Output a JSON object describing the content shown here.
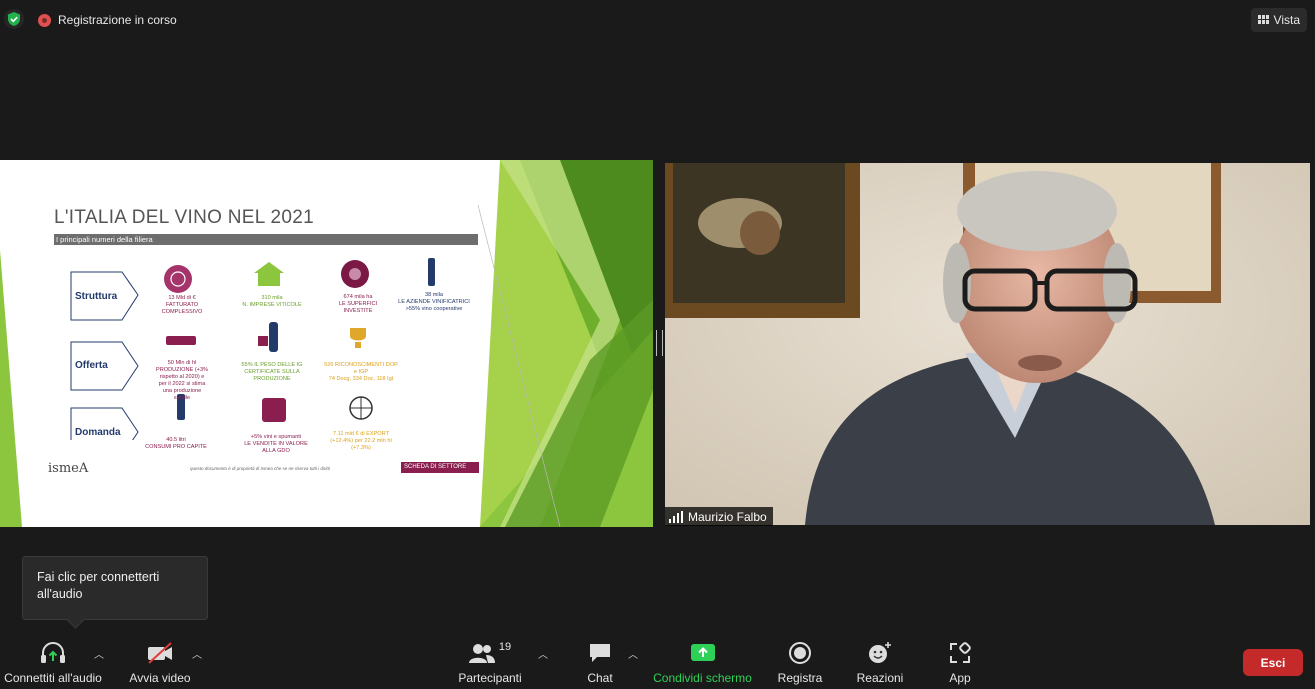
{
  "topbar": {
    "recording_label": "Registrazione in corso",
    "view_label": "Vista"
  },
  "slide": {
    "title": "L'ITALIA DEL VINO NEL 2021",
    "subtitle": "I principali numeri della filiera",
    "categories": [
      "Struttura",
      "Offerta",
      "Domanda"
    ],
    "stats": [
      {
        "text": "13  Mld di €\nFATTURATO\nCOMPLESSIVO",
        "color": "#8a1e4f"
      },
      {
        "text": "310 mila\nN. IMPRESE VITICOLE",
        "color": "#6aa02a"
      },
      {
        "text": "674 mila ha\nLE SUPERFICI\nINVESTITE",
        "color": "#8a1e4f"
      },
      {
        "text": "38 mila\nLE AZIENDE VINIFICATRICI\n>55% vino cooperative",
        "color": "#233a6b"
      },
      {
        "text": "50 Mln di hl\nPRODUZIONE (+3%\nrispetto al 2020) e\nper il 2022 si stima\nuna produzione\nstabile",
        "color": "#8a1e4f"
      },
      {
        "text": "55% IL PESO DELLE IG\nCERTIFICATE SULLA\nPRODUZIONE",
        "color": "#6aa02a"
      },
      {
        "text": "526 RICONOSCIMENTI DOP\ne IGP\n74 Docg, 334 Doc, 118 Igt",
        "color": "#d9a21b"
      },
      {
        "text": "40.5 litri\nCONSUMI PRO CAPITE",
        "color": "#8a1e4f"
      },
      {
        "text": "+5% vini e spumanti\nLE VENDITE IN VALORE\nALLA GDO",
        "color": "#8a1e4f"
      },
      {
        "text": "7.11 mld € di EXPORT\n(+12.4%) per 22.2 mln hl\n(+7.3%)",
        "color": "#d9a21b"
      }
    ],
    "footer_note": "questo documento è di proprietà di Ismea che se ne riserva tutti i diritti",
    "badge": "SCHEDA  DI SETTORE",
    "logo": "ismeA"
  },
  "participant": {
    "name": "Maurizio Falbo"
  },
  "tooltip": {
    "text": "Fai clic per connetterti all'audio"
  },
  "toolbar": {
    "audio_label": "Connettiti all'audio",
    "video_label": "Avvia video",
    "participants_label": "Partecipanti",
    "participants_count": "19",
    "chat_label": "Chat",
    "share_label": "Condividi schermo",
    "record_label": "Registra",
    "reactions_label": "Reazioni",
    "apps_label": "App",
    "leave_label": "Esci"
  },
  "colors": {
    "accent_green": "#2fd058",
    "leave_red": "#c42a2a",
    "slide_maroon": "#8a1e4f",
    "slide_lime": "#8cc63f"
  }
}
